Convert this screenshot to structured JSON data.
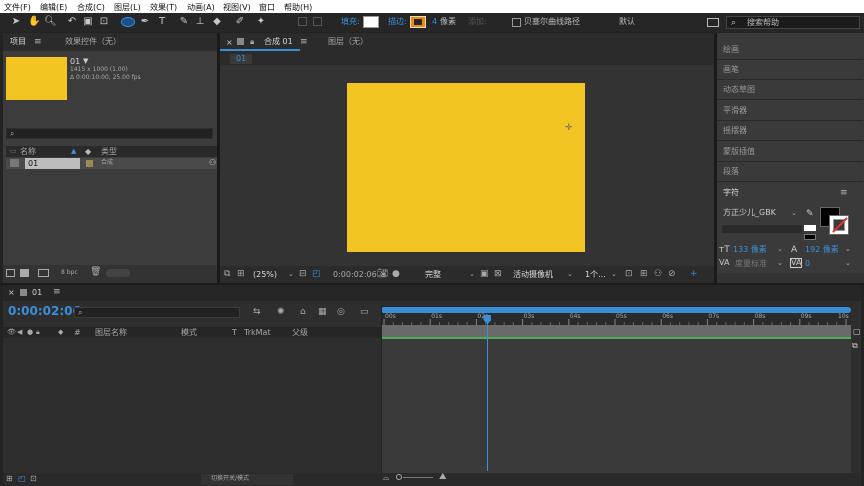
{
  "menubar": [
    "文件(F)",
    "编辑(E)",
    "合成(C)",
    "图层(L)",
    "效果(T)",
    "动画(A)",
    "视图(V)",
    "窗口",
    "帮助(H)"
  ],
  "toolbar": {
    "fill_label": "填充:",
    "stroke_label": "描边:",
    "stroke_value": "4",
    "stroke_unit": "像素",
    "add_label": "添加:",
    "bezier_label": "贝塞尔曲线路径",
    "default_label": "默认",
    "search_placeholder": "搜索帮助"
  },
  "project": {
    "tab": "项目",
    "effect_tab": "效果控件（无）",
    "comp_name": "01",
    "comp_dims": "1415 x 1000 (1.00)",
    "comp_duration": "Δ 0:00:10:00, 25.00 fps",
    "col_name": "名称",
    "col_type": "类型",
    "item_name": "01",
    "item_type": "合成",
    "bpc": "8 bpc"
  },
  "comp": {
    "tab": "合成 01",
    "layer_tab": "图层（无）",
    "breadcrumb": "01",
    "zoom": "(25%)",
    "timecode": "0:00:02:06",
    "quality": "完整",
    "camera": "活动摄像机",
    "views": "1个...",
    "layer_color": "#f2c523"
  },
  "right_panel": {
    "items": [
      "绘画",
      "画笔",
      "动态草图",
      "平滑器",
      "摇摆器",
      "蒙版插值",
      "段落"
    ],
    "char_title": "字符",
    "font": "方正少儿_GBK",
    "font_size": "133 像素",
    "leading": "192 像素",
    "kerning": "度量标准",
    "tracking": "0"
  },
  "timeline": {
    "tab": "01",
    "timecode": "0:00:02:06",
    "col_layer": "图层名称",
    "col_mode": "模式",
    "col_t": "T",
    "col_trkmat": "TrkMat",
    "col_parent": "父级",
    "ticks": [
      "00s",
      "01s",
      "02s",
      "03s",
      "04s",
      "05s",
      "06s",
      "07s",
      "08s",
      "09s",
      "10s"
    ],
    "playhead_sec": 2.24,
    "bottom_label": "切换开关/模式"
  }
}
